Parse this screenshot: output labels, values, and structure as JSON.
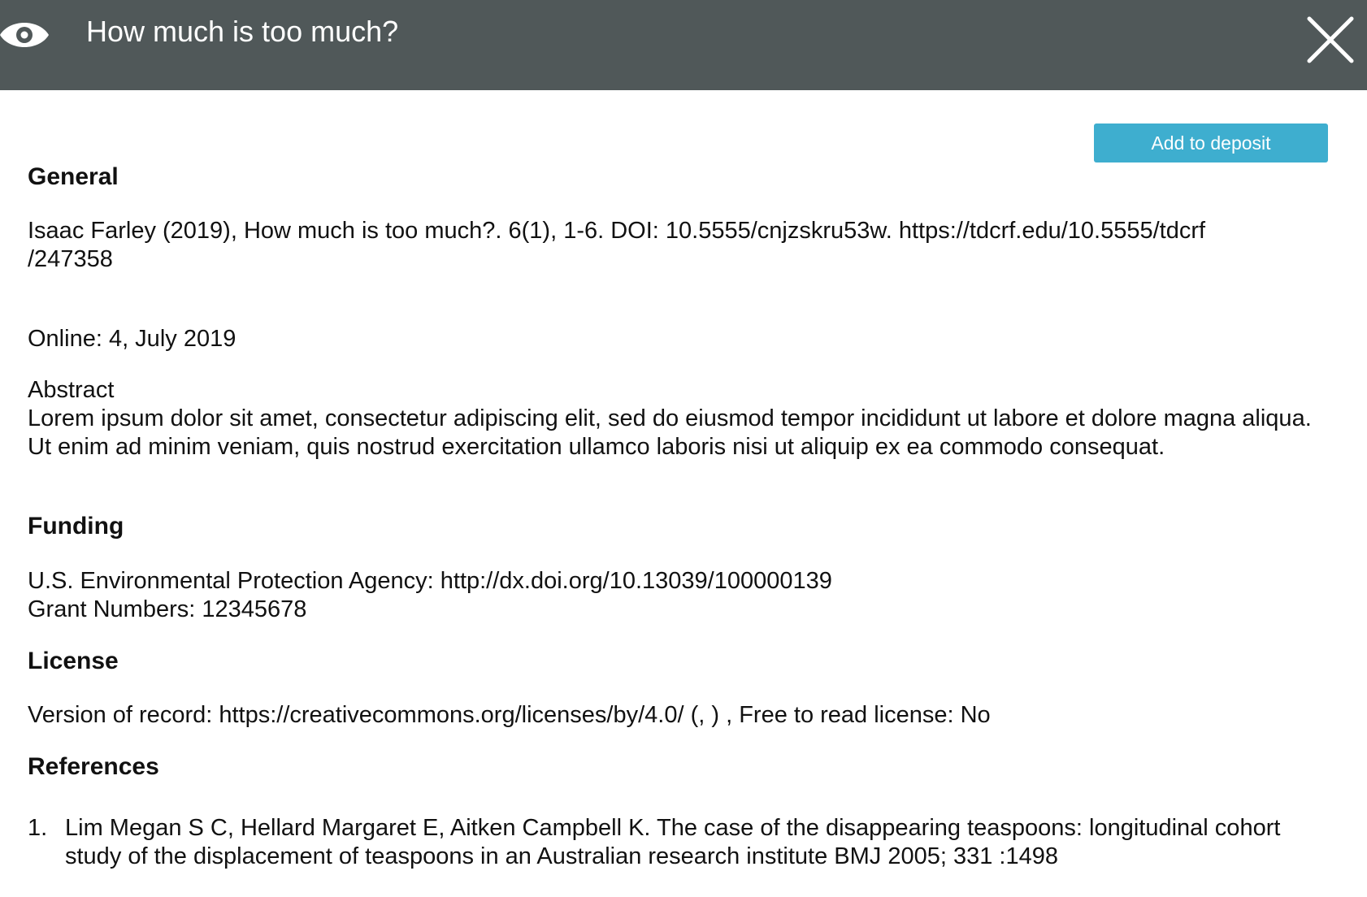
{
  "header": {
    "title": "How much is too much?",
    "icon": "eye-icon",
    "close_icon": "close-icon"
  },
  "toolbar": {
    "deposit_label": "Add to deposit"
  },
  "colors": {
    "header_bg": "#505859",
    "accent": "#3eaecf"
  },
  "general": {
    "heading": "General",
    "citation_line1": "Isaac Farley (2019), How much is too much?. 6(1), 1-6. DOI: 10.5555/cnjzskru53w. https://tdcrf.edu/10.5555/tdcrf",
    "citation_line2": "/247358",
    "online": "Online: 4, July 2019",
    "abstract_label": "Abstract",
    "abstract_text": "Lorem ipsum dolor sit amet, consectetur adipiscing elit, sed do eiusmod tempor incididunt ut labore et dolore magna aliqua. Ut enim ad minim veniam, quis nostrud exercitation ullamco laboris nisi ut aliquip ex ea commodo consequat."
  },
  "funding": {
    "heading": "Funding",
    "agency": "U.S. Environmental Protection Agency: http://dx.doi.org/10.13039/100000139",
    "grants": "Grant Numbers: 12345678"
  },
  "license": {
    "heading": "License",
    "text": "Version of record: https://creativecommons.org/licenses/by/4.0/ (, ) , Free to read license: No"
  },
  "references": {
    "heading": "References",
    "items": [
      {
        "number": "1.",
        "text": "Lim Megan S C, Hellard Margaret E, Aitken Campbell K. The case of the disappearing teaspoons: longitudinal cohort study of the displacement of teaspoons in an Australian research institute BMJ 2005; 331 :1498"
      }
    ]
  }
}
